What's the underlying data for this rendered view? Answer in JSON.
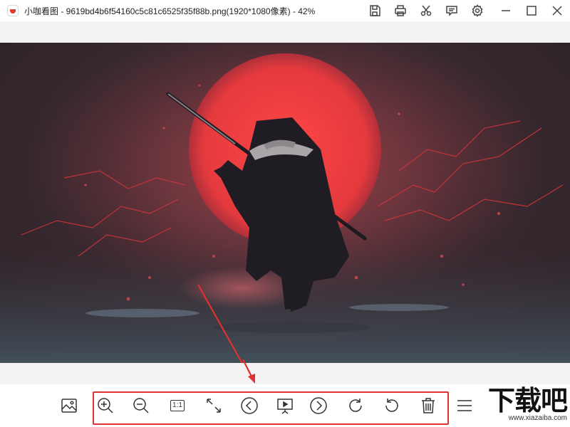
{
  "window": {
    "title": "小咖看图 - 9619bd4b6f54160c5c81c6525f35f88b.png(1920*1080像素) - 42%",
    "icons": [
      "save-icon",
      "print-icon",
      "cut-icon",
      "comment-icon",
      "gear-icon",
      "minimize-icon",
      "maximize-icon",
      "close-icon"
    ]
  },
  "toolbar": {
    "tools": [
      {
        "name": "image-thumbnail-icon"
      },
      {
        "name": "zoom-in-icon"
      },
      {
        "name": "zoom-out-icon"
      },
      {
        "name": "actual-size-icon",
        "label": "1:1"
      },
      {
        "name": "fit-window-icon"
      },
      {
        "name": "previous-icon"
      },
      {
        "name": "slideshow-icon"
      },
      {
        "name": "next-icon"
      },
      {
        "name": "rotate-right-icon"
      },
      {
        "name": "rotate-left-icon"
      },
      {
        "name": "delete-icon"
      },
      {
        "name": "menu-icon"
      }
    ],
    "highlight_color": "#e03030"
  },
  "annotation": {
    "arrow_color": "#e03030"
  },
  "watermark": {
    "main": "下载吧",
    "sub": "www.xiazaiba.com"
  }
}
